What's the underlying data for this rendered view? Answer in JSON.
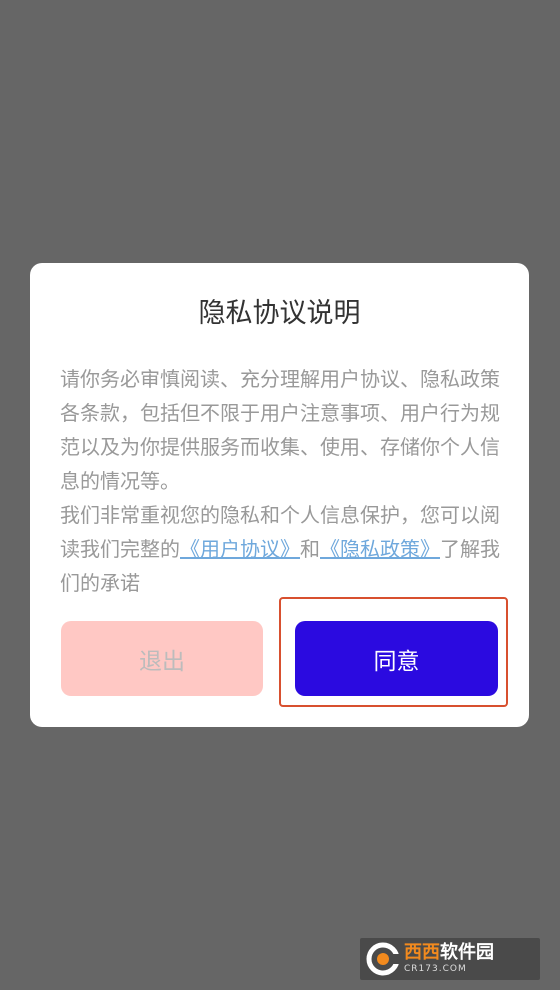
{
  "dialog": {
    "title": "隐私协议说明",
    "paragraph1": "请你务必审慎阅读、充分理解用户协议、隐私政策各条款，包括但不限于用户注意事项、用户行为规范以及为你提供服务而收集、使用、存储你个人信息的情况等。",
    "paragraph2_prefix": "我们非常重视您的隐私和个人信息保护，您可以阅读我们完整的",
    "link_user_agreement": "《用户协议》",
    "and_text": "和",
    "link_privacy_policy": "《隐私政策》",
    "paragraph2_suffix": "了解我们的承诺",
    "exit_label": "退出",
    "agree_label": "同意"
  },
  "watermark": {
    "main_orange": "西西",
    "main_white": "软件园",
    "sub": "CR173.COM"
  },
  "colors": {
    "overlay": "#666666",
    "agree_button": "#2b0ae0",
    "exit_button": "#ffc8c4",
    "link": "#6fa8dc",
    "highlight": "#d8502f"
  }
}
